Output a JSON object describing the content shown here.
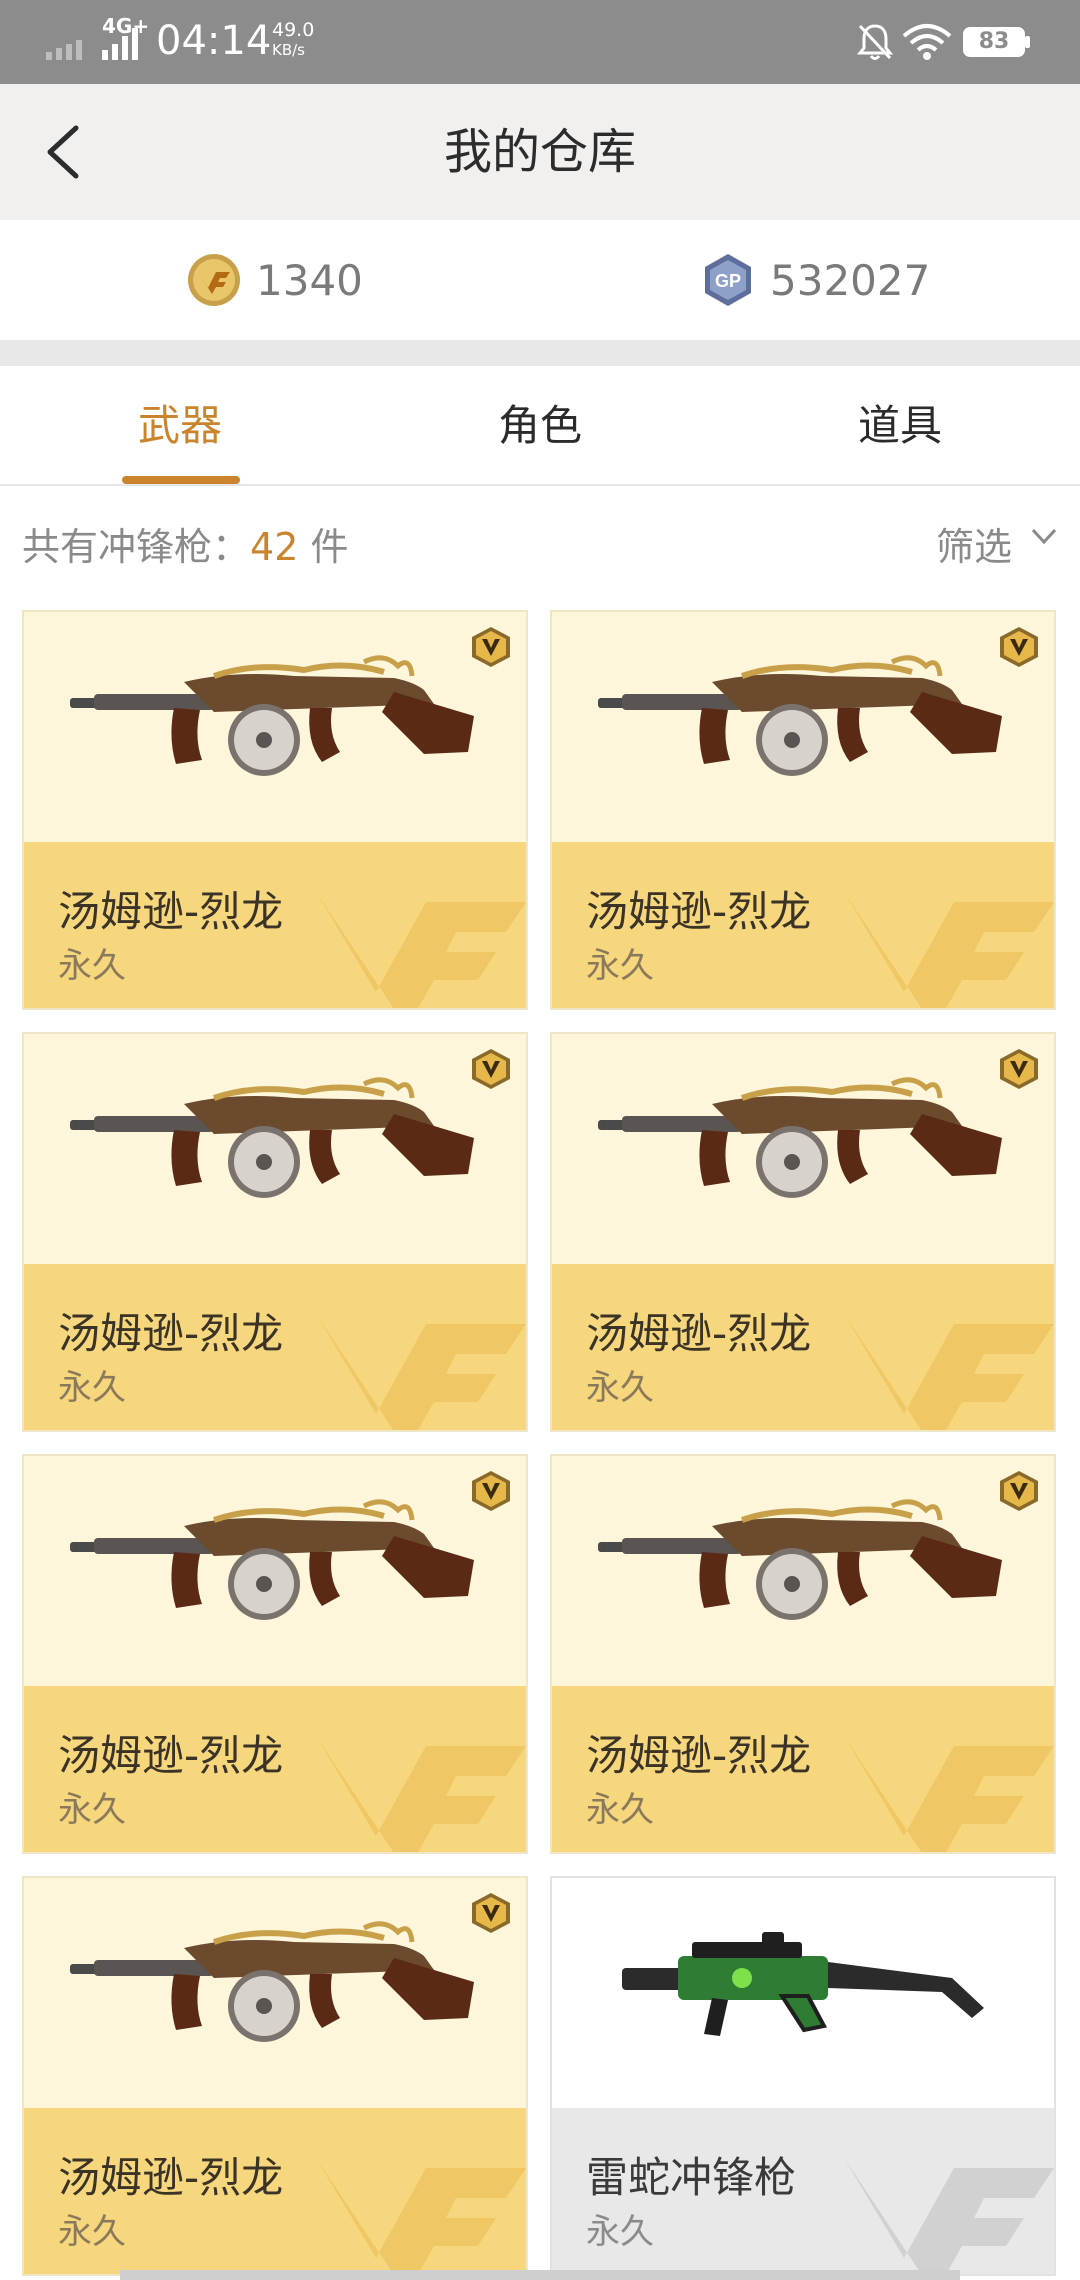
{
  "status_bar": {
    "network": "4G+",
    "time": "04:14",
    "speed_value": "49.0",
    "speed_unit": "KB/s",
    "battery": "83"
  },
  "header": {
    "title": "我的仓库"
  },
  "currency": {
    "cf_points": "1340",
    "gp": "532027",
    "gp_icon_text": "GP"
  },
  "tabs": [
    {
      "label": "武器"
    },
    {
      "label": "角色"
    },
    {
      "label": "道具"
    }
  ],
  "count": {
    "label": "共有冲锋枪：",
    "value": "42",
    "unit": "件"
  },
  "filter": {
    "label": "筛选"
  },
  "items": [
    {
      "name": "汤姆逊-烈龙",
      "duration": "永久",
      "vip": true
    },
    {
      "name": "汤姆逊-烈龙",
      "duration": "永久",
      "vip": true
    },
    {
      "name": "汤姆逊-烈龙",
      "duration": "永久",
      "vip": true
    },
    {
      "name": "汤姆逊-烈龙",
      "duration": "永久",
      "vip": true
    },
    {
      "name": "汤姆逊-烈龙",
      "duration": "永久",
      "vip": true
    },
    {
      "name": "汤姆逊-烈龙",
      "duration": "永久",
      "vip": true
    },
    {
      "name": "汤姆逊-烈龙",
      "duration": "永久",
      "vip": true
    },
    {
      "name": "雷蛇冲锋枪",
      "duration": "永久",
      "vip": false
    }
  ],
  "colors": {
    "accent": "#c9842c",
    "card_top": "#fdf6da",
    "card_bottom": "#f7d77e"
  }
}
